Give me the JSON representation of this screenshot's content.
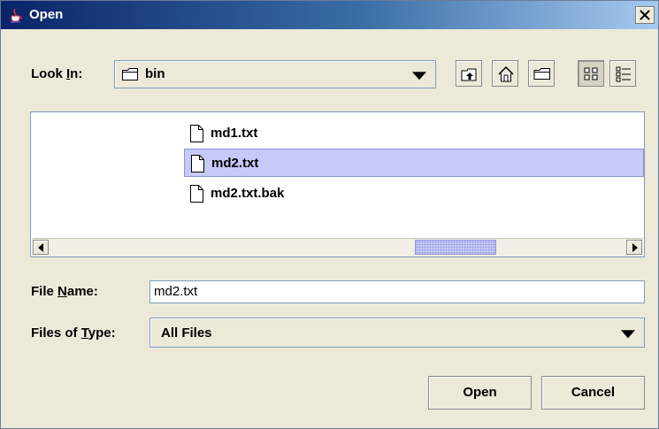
{
  "window": {
    "title": "Open"
  },
  "look_in": {
    "label_before": "Look ",
    "label_mnemonic": "I",
    "label_after": "n:",
    "value": "bin"
  },
  "toolbar": [
    "up-one-level",
    "home",
    "new-folder",
    "list-view",
    "details-view"
  ],
  "files": [
    {
      "name": "md1.txt",
      "selected": false
    },
    {
      "name": "md2.txt",
      "selected": true
    },
    {
      "name": "md2.txt.bak",
      "selected": false
    }
  ],
  "scrollbar": {
    "position_fraction": 0.66
  },
  "file_name": {
    "label_before": "File ",
    "label_mnemonic": "N",
    "label_after": "ame:",
    "value": "md2.txt"
  },
  "files_of_type": {
    "label_before": "Files of ",
    "label_mnemonic": "T",
    "label_after": "ype:",
    "value": "All Files"
  },
  "buttons": {
    "open": "Open",
    "cancel": "Cancel"
  },
  "colors": {
    "selection": "#c7c9f6",
    "titlebar": "#0a246a",
    "panel": "#ece9d8"
  }
}
